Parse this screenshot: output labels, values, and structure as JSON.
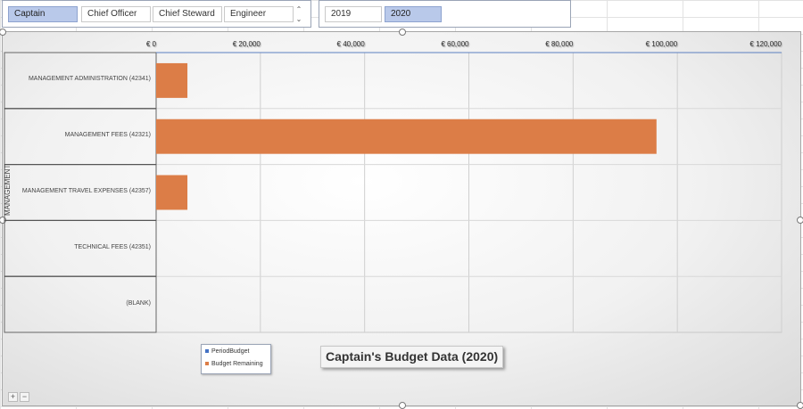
{
  "slicers": {
    "role": {
      "items": [
        {
          "label": "Captain",
          "selected": true
        },
        {
          "label": "Chief Officer",
          "selected": false
        },
        {
          "label": "Chief Steward",
          "selected": false
        },
        {
          "label": "Engineer",
          "selected": false
        }
      ]
    },
    "year": {
      "items": [
        {
          "label": "2019",
          "selected": false
        },
        {
          "label": "2020",
          "selected": true
        }
      ]
    }
  },
  "colors": {
    "period_budget": "#4472c4",
    "budget_remaining": "#dc7d47"
  },
  "chart_data": {
    "type": "bar",
    "orientation": "horizontal",
    "title": "Captain's Budget Data (2020)",
    "xlabel": "",
    "ylabel": "MANAGEMENT",
    "categories": [
      "MANAGEMENT ADMINISTRATION (42341)",
      "MANAGEMENT FEES (42321)",
      "MANAGEMENT TRAVEL EXPENSES (42357)",
      "TECHNICAL FEES (42351)",
      "(BLANK)"
    ],
    "series": [
      {
        "name": "PeriodBudget",
        "values": [
          0,
          0,
          0,
          0,
          0
        ]
      },
      {
        "name": "Budget Remaining",
        "values": [
          6000,
          96000,
          6000,
          0,
          0
        ]
      }
    ],
    "xlim": [
      0,
      120000
    ],
    "xticks": [
      "€ 0",
      "€ 20,000",
      "€ 40,000",
      "€ 60,000",
      "€ 80,000",
      "€ 100,000",
      "€ 120,000"
    ],
    "grid": true,
    "legend": "bottom-left"
  },
  "zoom": {
    "plus": "+",
    "minus": "−"
  }
}
